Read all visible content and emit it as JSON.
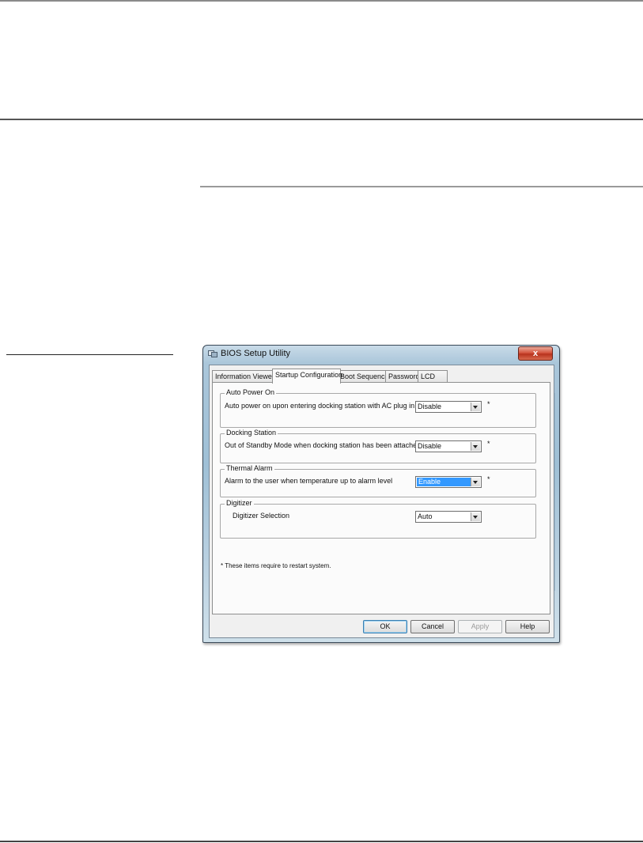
{
  "window": {
    "title": "BIOS Setup Utility",
    "close_label": "x"
  },
  "tabs": [
    {
      "label": "Information Viewer",
      "active": false
    },
    {
      "label": "Startup Configuration",
      "active": true
    },
    {
      "label": "Boot Sequence",
      "active": false
    },
    {
      "label": "Password",
      "active": false
    },
    {
      "label": "LCD",
      "active": false
    }
  ],
  "groups": {
    "auto_power_on": {
      "legend": "Auto Power On",
      "description": "Auto power on upon entering docking station with AC plug in",
      "value": "Disable",
      "asterisk": "*"
    },
    "docking_station": {
      "legend": "Docking Station",
      "description": "Out of Standby Mode when docking station has been attached",
      "value": "Disable",
      "asterisk": "*"
    },
    "thermal_alarm": {
      "legend": "Thermal Alarm",
      "description": "Alarm to the user when temperature up to alarm level",
      "value": "Enable",
      "asterisk": "*"
    },
    "digitizer": {
      "legend": "Digitizer",
      "description": "Digitizer Selection",
      "value": "Auto"
    }
  },
  "note": "* These items require to restart system.",
  "buttons": {
    "ok": "OK",
    "cancel": "Cancel",
    "apply": "Apply",
    "help": "Help"
  },
  "colors": {
    "selection": "#3399ff",
    "close_button": "#c8432b"
  }
}
